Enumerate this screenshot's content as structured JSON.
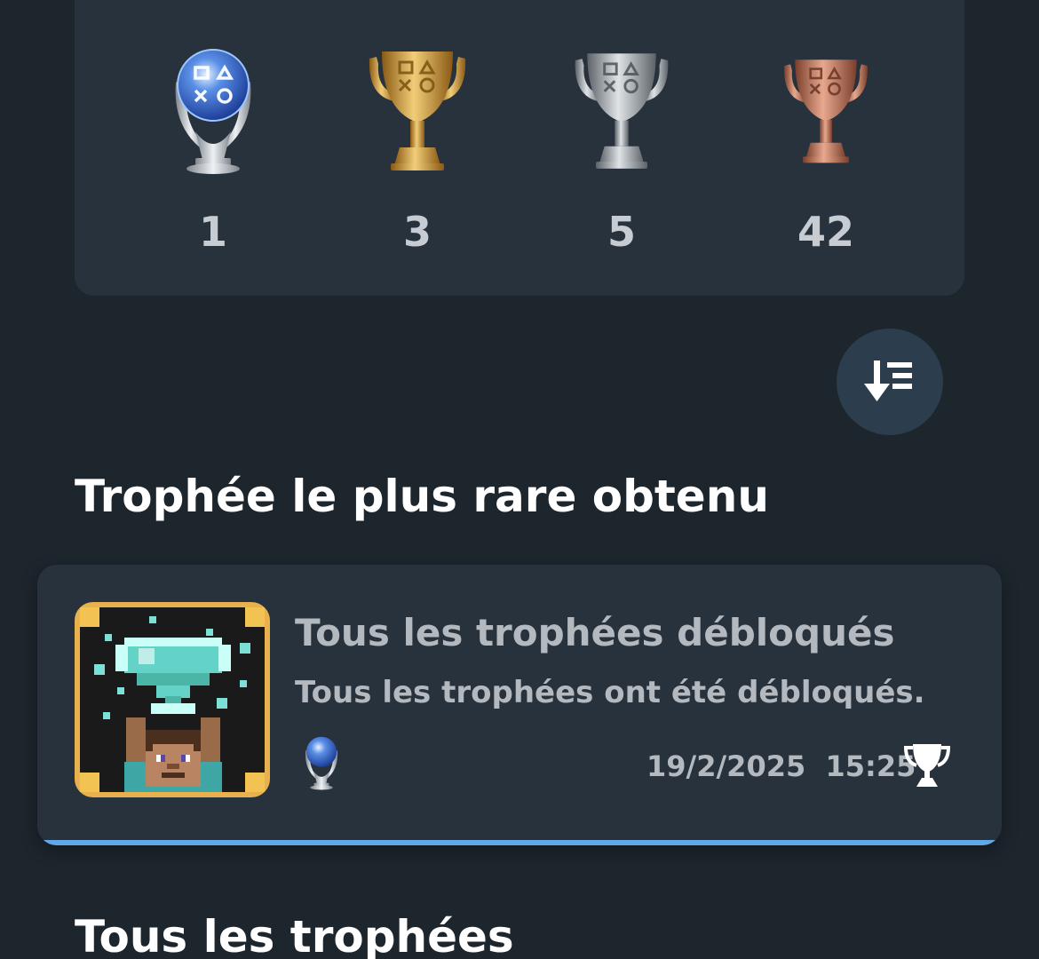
{
  "summary": {
    "trophies": [
      {
        "grade": "platinum",
        "icon": "platinum-trophy-icon",
        "count": "1"
      },
      {
        "grade": "gold",
        "icon": "gold-trophy-icon",
        "count": "3"
      },
      {
        "grade": "silver",
        "icon": "silver-trophy-icon",
        "count": "5"
      },
      {
        "grade": "bronze",
        "icon": "bronze-trophy-icon",
        "count": "42"
      }
    ]
  },
  "sort_button": {
    "icon": "sort-descending-icon"
  },
  "rarest": {
    "heading": "Trophée le plus rare obtenu",
    "title": "Tous les trophées débloqués",
    "description": "Tous les trophées ont été débloqués.",
    "grade_icon": "platinum-trophy-icon",
    "date": "19/2/2025",
    "time": "15:25",
    "earned_icon": "trophy-earned-icon"
  },
  "all_trophies": {
    "heading": "Tous les trophées"
  },
  "colors": {
    "background": "#1d252d",
    "card": "#28323d",
    "accent": "#62a8e8",
    "muted_text": "#b4b9bf"
  }
}
